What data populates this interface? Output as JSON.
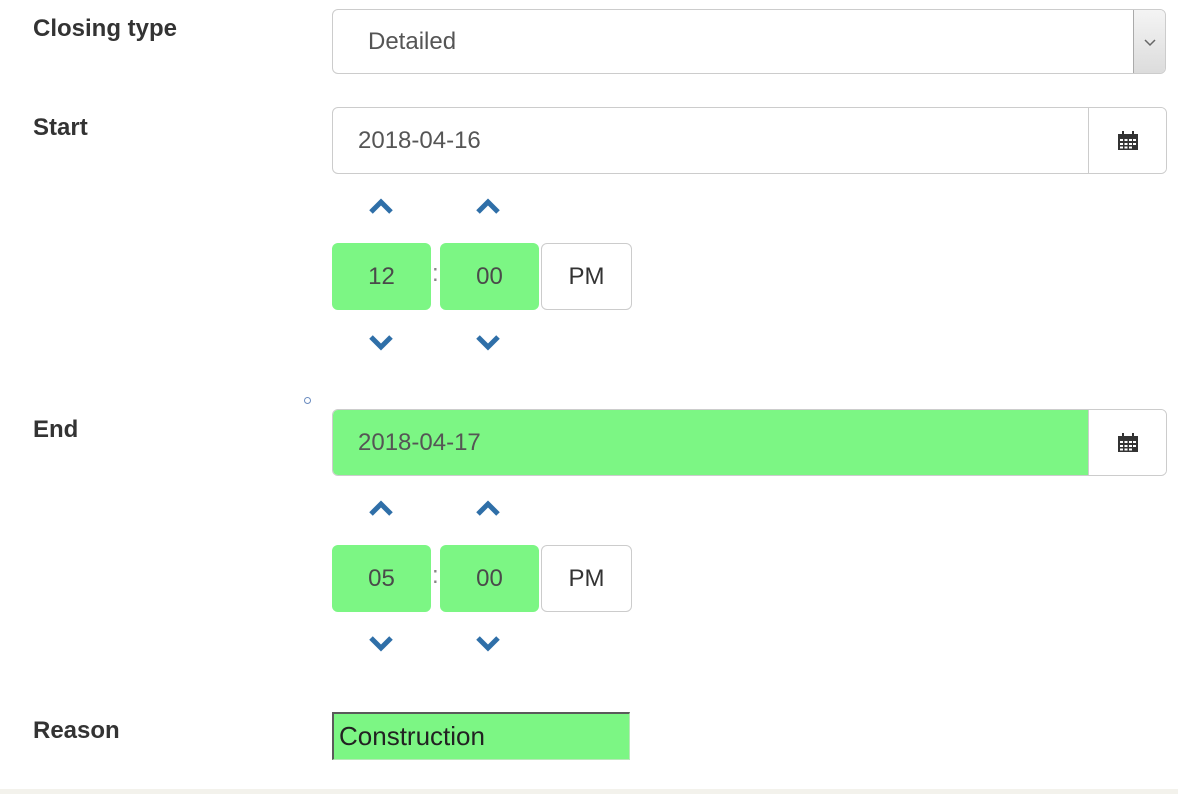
{
  "form": {
    "closing_type": {
      "label": "Closing type",
      "value": "Detailed"
    },
    "start": {
      "label": "Start",
      "date": "2018-04-16",
      "hour": "12",
      "minute": "00",
      "separator": ":",
      "period": "PM"
    },
    "end": {
      "label": "End",
      "date": "2018-04-17",
      "hour": "05",
      "minute": "00",
      "separator": ":",
      "period": "PM"
    },
    "reason": {
      "label": "Reason",
      "value": "Construction"
    }
  },
  "icons": {
    "select_arrow": "chevron-down-icon",
    "calendar": "calendar-icon",
    "increment": "chevron-up-icon",
    "decrement": "chevron-down-icon"
  },
  "colors": {
    "valid_field": "#7cf684",
    "chevron": "#2f6fa8",
    "label_text": "#333333"
  }
}
